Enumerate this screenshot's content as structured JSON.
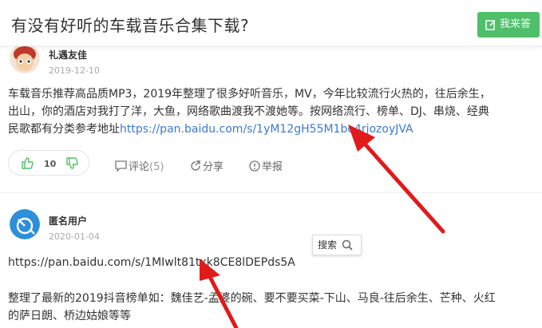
{
  "header": {
    "title": "有没有好听的车载音乐合集下载?",
    "ask_button": "我来答"
  },
  "answers": [
    {
      "author": "礼遇友佳",
      "date": "2019-12-10",
      "text_line1": "车载音乐推荐高品质MP3，2019年整理了很多好听音乐，MV，今年比较流行火热的，往后余生，",
      "text_line2": "出山，你的酒店对我打了洋，大鱼，网络歌曲渡我不渡她等。按网络流行、榜单、DJ、串烧、经典",
      "text_line3_prefix": "民歌都有分类参考地址",
      "link": "https://pan.baidu.com/s/1yM12gH55M1bo4rjozoyJVA",
      "votes_up": "10",
      "comment_label": "评论",
      "comment_count": "(5)",
      "share_label": "分享",
      "report_label": "举报"
    },
    {
      "author": "匿名用户",
      "date": "2020-01-04",
      "link": "https://pan.baidu.com/s/1MIwlt81txk8CE8lDEPds5A",
      "text_line1": "整理了最新的2019抖音榜单如：魏佳艺-孟婆的碗、要不要买菜-下山、马良-往后余生、芒种、火红",
      "text_line2": "的萨日朗、桥边姑娘等等"
    }
  ],
  "search_tip": "搜索",
  "colors": {
    "accent_green": "#4fbf6a",
    "link_blue": "#3b7ad6",
    "arrow_red": "#e11a1a"
  }
}
